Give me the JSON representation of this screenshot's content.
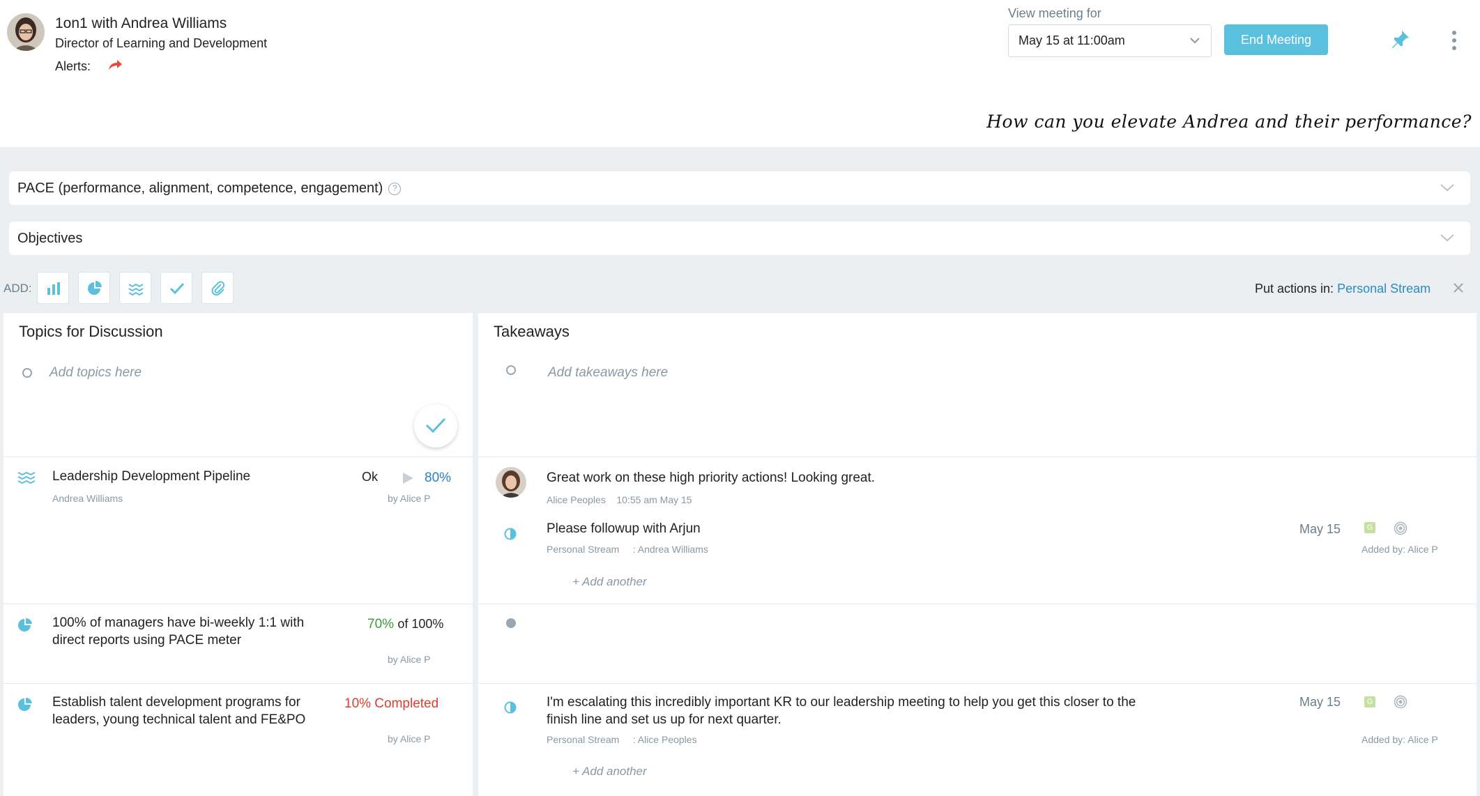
{
  "header": {
    "title": "1on1 with Andrea Williams",
    "role": "Director of Learning and Development",
    "alerts_label": "Alerts:",
    "view_meeting_label": "View meeting for",
    "meeting_selected": "May 15 at 11:00am",
    "end_meeting_label": "End Meeting",
    "tagline": "How can you elevate Andrea and their performance?"
  },
  "sections": {
    "pace_label": "PACE (performance, alignment, competence, engagement)",
    "objectives_label": "Objectives"
  },
  "add_row": {
    "label": "ADD:",
    "put_actions_label": "Put actions in:",
    "put_actions_link": "Personal Stream"
  },
  "topics": {
    "title": "Topics for Discussion",
    "placeholder": "Add topics here",
    "items": [
      {
        "title": "Leadership Development Pipeline",
        "owner": "Andrea Williams",
        "status": "Ok",
        "percent": "80%",
        "by": "by Alice P"
      },
      {
        "title_line1": "100% of managers have bi-weekly 1:1 with",
        "title_line2": "direct reports using PACE meter",
        "progress": "70%",
        "progress_suffix": "of 100%",
        "by": "by Alice P"
      },
      {
        "title_line1": "Establish talent development programs for",
        "title_line2": "leaders, young technical talent and FE&PO",
        "progress": "10% Completed",
        "by": "by Alice P"
      }
    ]
  },
  "takeaways": {
    "title": "Takeaways",
    "placeholder": "Add takeaways here",
    "comment": {
      "text": "Great work on these high priority actions! Looking great.",
      "author": "Alice Peoples",
      "time": "10:55 am May 15"
    },
    "actions": [
      {
        "text": "Please followup with Arjun",
        "stream": "Personal Stream",
        "assignee": ": Andrea Williams",
        "date": "May 15",
        "tag": "G",
        "added_by": "Added by:  Alice P",
        "add_another": "+ Add another"
      },
      {
        "text_line1": "I'm escalating this incredibly important KR to our leadership meeting to help you get this closer to the",
        "text_line2": "finish line and set us up for next quarter.",
        "stream": "Personal Stream",
        "assignee": ": Alice Peoples",
        "date": "May 15",
        "tag": "G",
        "added_by": "Added by:  Alice P",
        "add_another": "+ Add another"
      }
    ]
  },
  "colors": {
    "accent": "#5bc0de",
    "link": "#2b8ac6",
    "green": "#3a9b3a",
    "red": "#e03c2e",
    "alert": "#e74c3c"
  }
}
